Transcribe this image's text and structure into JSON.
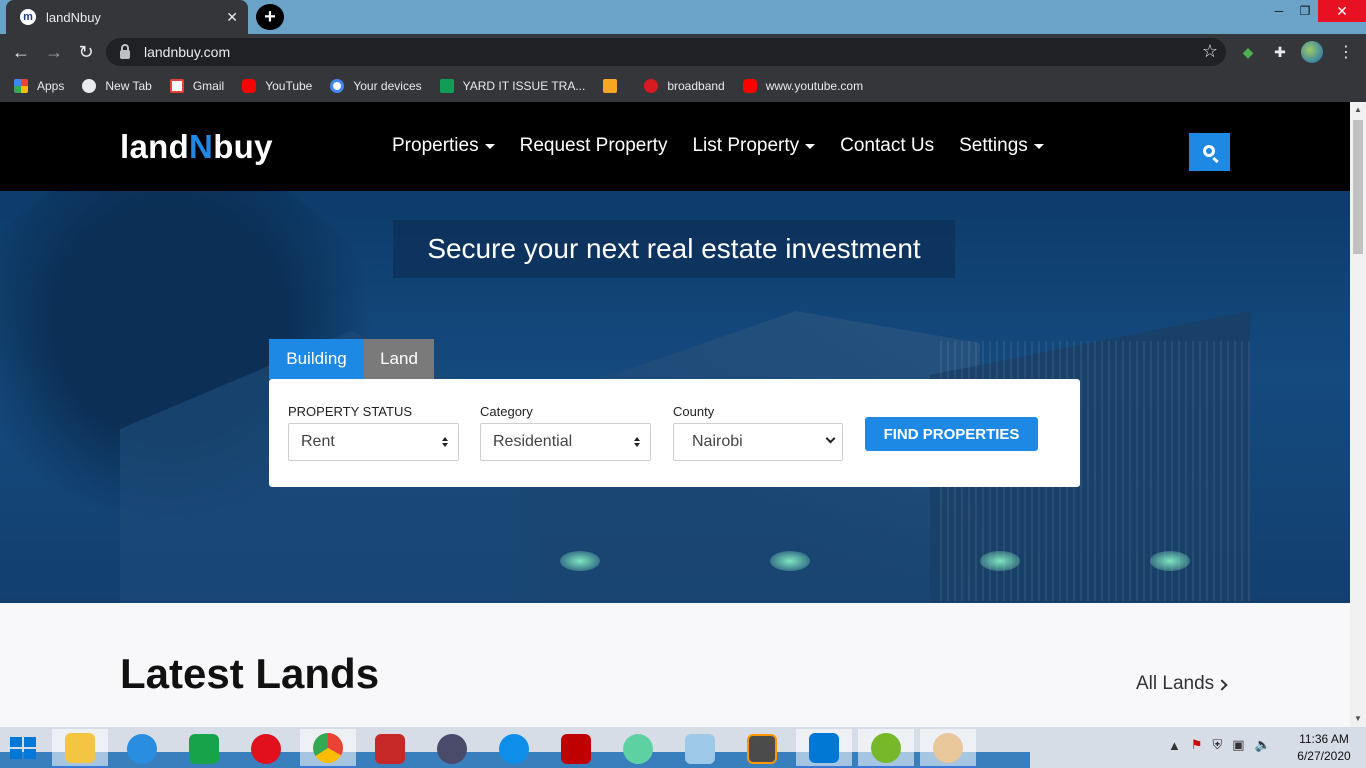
{
  "browser": {
    "tab_title": "landNbuy",
    "tab_close": "✕",
    "new_tab": "+",
    "url": "landnbuy.com",
    "window_controls": {
      "minimize": "─",
      "maximize": "❐",
      "close": "✕"
    },
    "nav": {
      "back": "←",
      "forward": "→",
      "reload": "↻"
    },
    "star": "☆",
    "menu": "⋮",
    "bookmarks": [
      {
        "label": "Apps",
        "icon": "apps-icon"
      },
      {
        "label": "New Tab",
        "icon": "globe-icon"
      },
      {
        "label": "Gmail",
        "icon": "gmail-icon"
      },
      {
        "label": "YouTube",
        "icon": "youtube-icon"
      },
      {
        "label": "Your devices",
        "icon": "google-icon"
      },
      {
        "label": "YARD IT ISSUE TRA...",
        "icon": "sheets-icon"
      },
      {
        "label": "",
        "icon": "yard-icon"
      },
      {
        "label": "broadband",
        "icon": "broadband-icon"
      },
      {
        "label": "www.youtube.com",
        "icon": "youtube-icon"
      }
    ]
  },
  "site": {
    "logo": {
      "part1": "land",
      "part2": "N",
      "part3": "buy"
    },
    "menu": [
      {
        "label": "Properties",
        "dropdown": true
      },
      {
        "label": "Request Property",
        "dropdown": false
      },
      {
        "label": "List Property",
        "dropdown": true
      },
      {
        "label": "Contact Us",
        "dropdown": false
      },
      {
        "label": "Settings",
        "dropdown": true
      }
    ],
    "accent_color": "#1e88e5",
    "hero": {
      "title": "Secure your next real estate investment",
      "tabs": {
        "building": "Building",
        "land": "Land"
      },
      "fields": {
        "status": {
          "label": "PROPERTY STATUS",
          "value": "Rent"
        },
        "category": {
          "label": "Category",
          "value": "Residential"
        },
        "county": {
          "label": "County",
          "value": "Nairobi"
        }
      },
      "button": "FIND PROPERTIES"
    },
    "latest": {
      "title": "Latest Lands",
      "link": "All Lands"
    }
  },
  "taskbar": {
    "clock_time": "11:36 AM",
    "clock_date": "6/27/2020",
    "apps": [
      "file-explorer",
      "internet-explorer",
      "store",
      "opera",
      "chrome",
      "app-red",
      "app-obs",
      "teamviewer",
      "filezilla",
      "atom",
      "notepad",
      "sublime-text",
      "vscode",
      "utorrent",
      "paint"
    ]
  }
}
